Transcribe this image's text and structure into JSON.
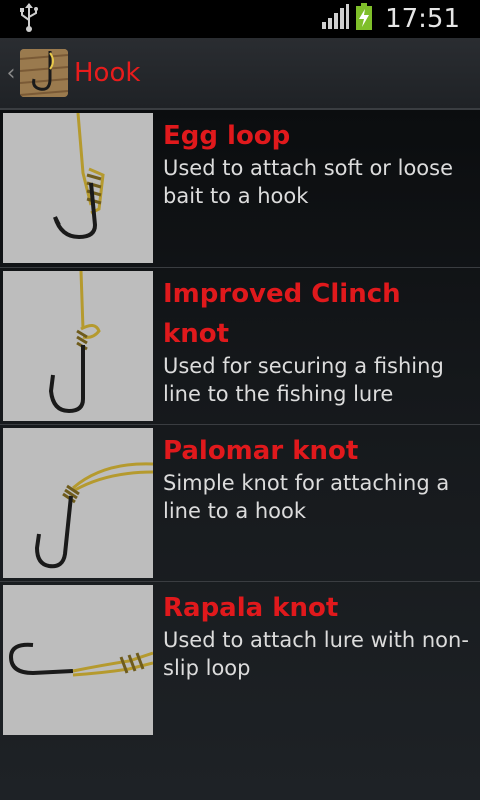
{
  "status_bar": {
    "time": "17:51",
    "icons": [
      "usb-icon",
      "signal-icon",
      "battery-charging-icon"
    ]
  },
  "action_bar": {
    "title": "Hook",
    "icon": "hook-knot-app-icon"
  },
  "items": [
    {
      "title": "Egg loop",
      "description": "Used to attach soft or loose bait to a hook"
    },
    {
      "title": "Improved Clinch knot",
      "description": "Used for securing a fishing line to the fishing lure"
    },
    {
      "title": "Palomar knot",
      "description": "Simple knot for attaching a line to a hook"
    },
    {
      "title": "Rapala knot",
      "description": "Used to attach lure with non-slip loop"
    }
  ],
  "colors": {
    "accent": "#e0191c",
    "thumb_bg": "#bdbdbd",
    "line": "#b59a2e",
    "hook": "#1a1a1a"
  }
}
